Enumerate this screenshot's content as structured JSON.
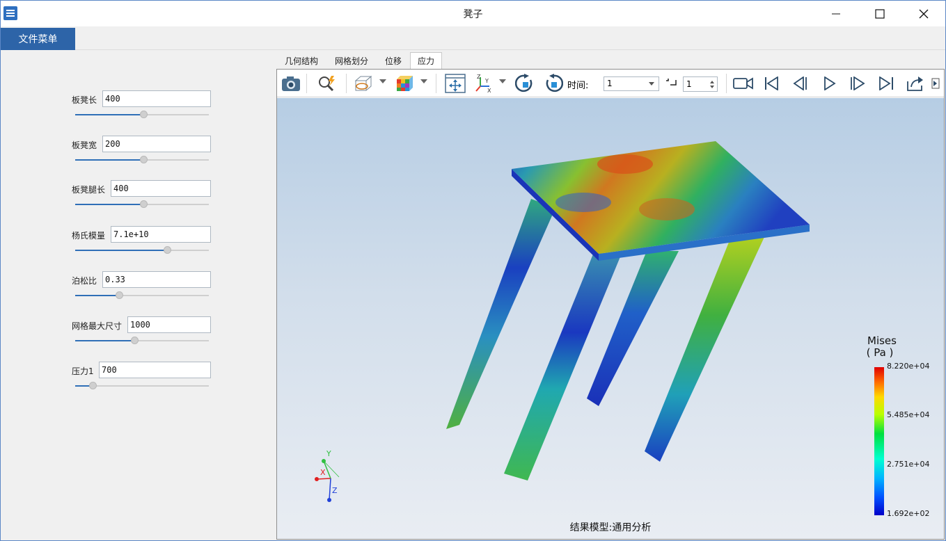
{
  "window": {
    "title": "凳子"
  },
  "menubar": {
    "file_menu": "文件菜单"
  },
  "parameters": [
    {
      "label": "板凳长",
      "value": "400",
      "slider": 0.51
    },
    {
      "label": "板凳宽",
      "value": "200",
      "slider": 0.51
    },
    {
      "label": "板凳腿长",
      "value": "400",
      "slider": 0.51
    },
    {
      "label": "杨氏模量",
      "value": "7.1e+10",
      "slider": 0.69
    },
    {
      "label": "泊松比",
      "value": "0.33",
      "slider": 0.33
    },
    {
      "label": "网格最大尺寸",
      "value": "1000",
      "slider": 0.44
    },
    {
      "label": "压力1",
      "value": "700",
      "slider": 0.13
    }
  ],
  "tabs": [
    {
      "label": "几何结构",
      "active": false
    },
    {
      "label": "网格划分",
      "active": false
    },
    {
      "label": "位移",
      "active": false
    },
    {
      "label": "应力",
      "active": true
    }
  ],
  "toolbar": {
    "time_label": "时间:",
    "time_value": "1",
    "step_value": "1",
    "icons": [
      "camera-icon",
      "zoom-fit-icon",
      "display-mode-icon",
      "color-cube-icon",
      "pan-icon",
      "axes-orient-icon",
      "rotate-cw-icon",
      "rotate-ccw-icon",
      "record-video-icon",
      "first-frame-icon",
      "prev-frame-icon",
      "play-icon",
      "next-frame-icon",
      "last-frame-icon",
      "export-icon"
    ]
  },
  "viewport": {
    "legend_title_1": "Mises",
    "legend_title_2": "( Pa )",
    "legend_ticks": [
      "8.220e+04",
      "5.485e+04",
      "2.751e+04",
      "1.692e+02"
    ],
    "legend_values": [
      82200,
      54850,
      27510,
      169.2
    ],
    "triad": {
      "x": "X",
      "y": "Y",
      "z": "Z"
    },
    "status": "结果模型:通用分析"
  }
}
